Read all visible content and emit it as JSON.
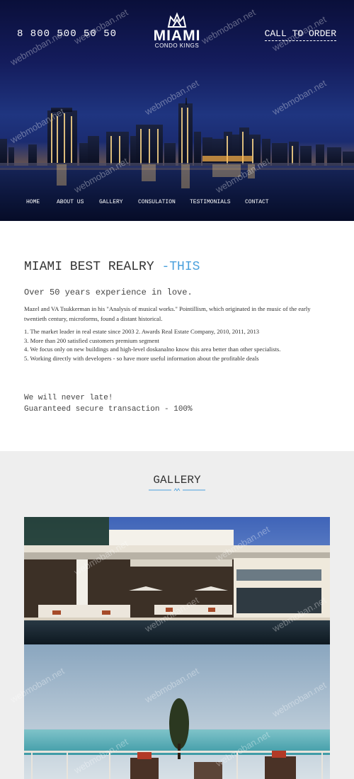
{
  "header": {
    "phone": "8 800 500 50 50",
    "call_to_order": "CALL TO ORDER",
    "logo": {
      "word": "MIAMI",
      "tagline": "CONDO KINGS",
      "icon": "crown-icon"
    }
  },
  "nav": {
    "items": [
      {
        "label": "HOME"
      },
      {
        "label": "ABOUT US"
      },
      {
        "label": "GALLERY"
      },
      {
        "label": "CONSULATION"
      },
      {
        "label": "TESTIMONIALS"
      },
      {
        "label": "CONTACT"
      }
    ]
  },
  "about": {
    "title": "MIAMI BEST REALRY",
    "title_accent": "-THIS",
    "experience": "Over 50 years experience in love.",
    "paragraph": "Mazel and VA Tsukkerman in his \"Analysis of musical works.\" Pointillism, which originated in the music of the early twentieth century, microforms, found a distant historical.",
    "list": [
      "1. The market leader in real estate since 2003   2. Awards Real Estate Company, 2010, 2011, 2013",
      "3. More than 200 satisfied customers premium segment",
      "4. We focus only on new buildings and high-level doskanalno know this area better than other specialists.",
      "5. Working directly with developers - so have more useful information about the profitable deals"
    ],
    "line1": "We will never late!",
    "line2": "Guaranteed secure transaction - 100%"
  },
  "gallery": {
    "title": "GALLERY"
  },
  "watermark": "webmoban.net",
  "colors": {
    "accent": "#4aa0dc",
    "hero_dark": "#0a0f3a",
    "gallery_bg": "#eeeeee"
  }
}
